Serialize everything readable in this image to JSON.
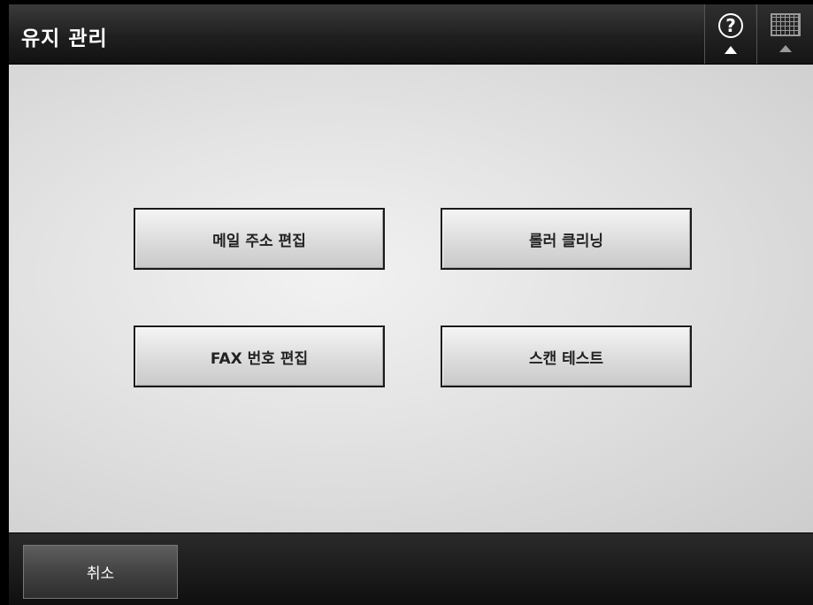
{
  "header": {
    "title": "유지 관리",
    "help_icon": "help-icon",
    "keyboard_icon": "keyboard-icon"
  },
  "main": {
    "buttons": [
      {
        "label": "메일 주소 편집"
      },
      {
        "label": "롤러 클리닝"
      },
      {
        "label": "FAX 번호 편집"
      },
      {
        "label": "스캔 테스트"
      }
    ]
  },
  "footer": {
    "cancel_label": "취소"
  },
  "colors": {
    "header_bg": "#1f1f1f",
    "content_bg": "#e2e2e2",
    "button_border": "#1a1a1a",
    "footer_bg": "#1a1a1a"
  }
}
